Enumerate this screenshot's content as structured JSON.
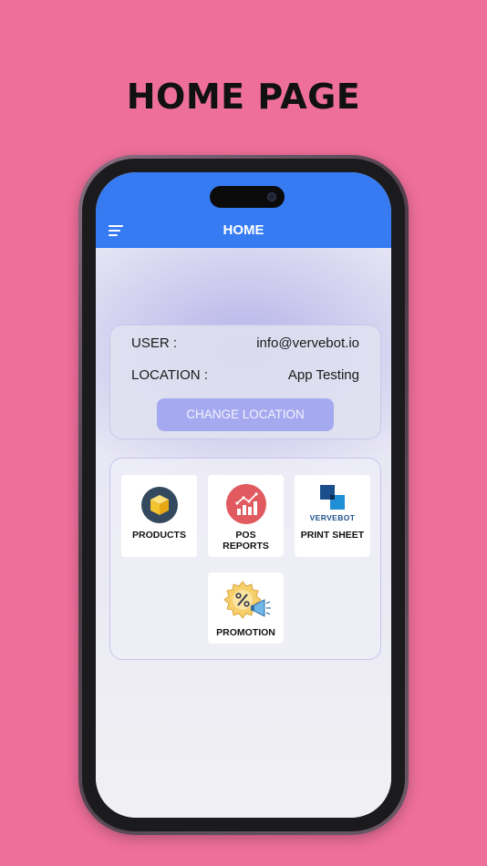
{
  "banner": {
    "title": "HOME PAGE"
  },
  "app_bar": {
    "title": "HOME",
    "menu_icon": "hamburger-menu-icon"
  },
  "user_info": {
    "user_label": "USER :",
    "user_value": "info@vervebot.io",
    "location_label": "LOCATION :",
    "location_value": "App Testing",
    "change_location_button": "CHANGE LOCATION"
  },
  "menu_tiles": [
    {
      "label": "PRODUCTS",
      "icon": "product-box-icon"
    },
    {
      "label_line1": "POS",
      "label_line2": "REPORTS",
      "icon": "pos-reports-chart-icon"
    },
    {
      "logo_text": "VERVEBOT",
      "label": "PRINT SHEET",
      "icon": "vervebot-logo-icon"
    },
    {
      "label": "PROMOTION",
      "icon": "promotion-badge-icon"
    }
  ],
  "colors": {
    "background": "#ee6f9a",
    "app_bar": "#377bf3",
    "button": "#a5a9ef",
    "products_icon_bg": "#34495e",
    "reports_icon_bg": "#e15a60"
  }
}
